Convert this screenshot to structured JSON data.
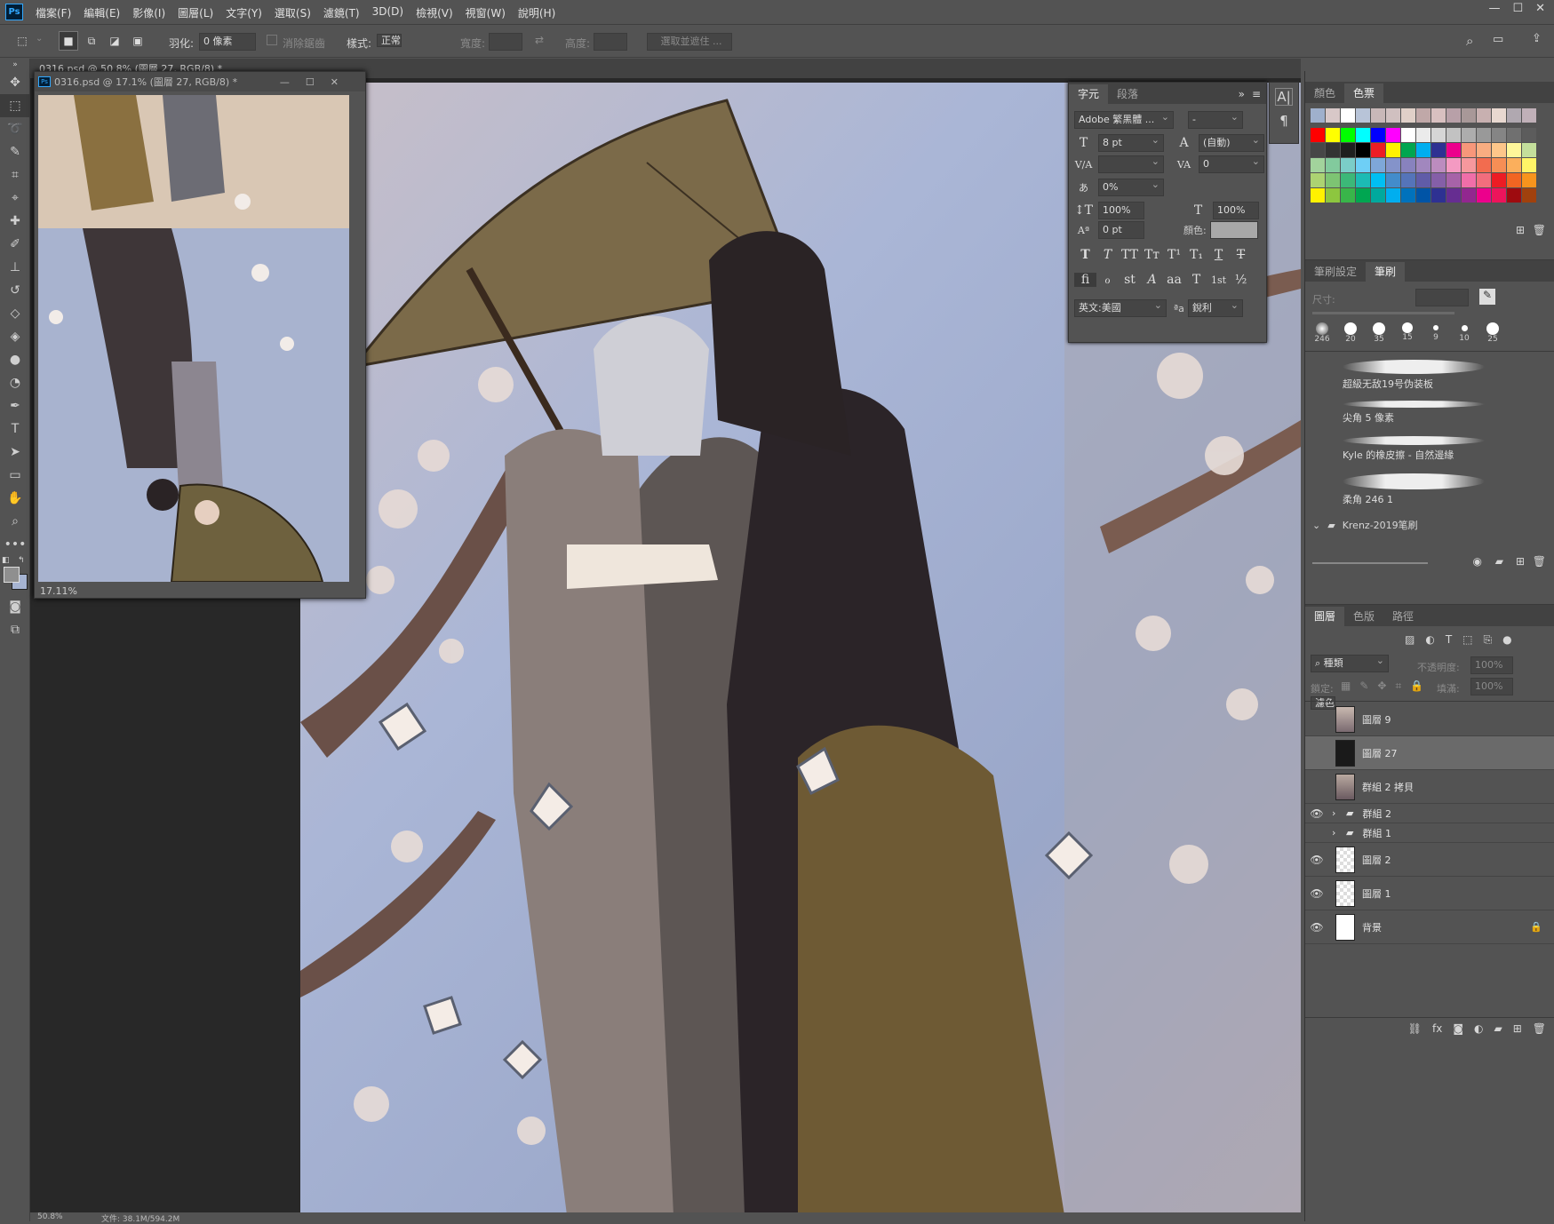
{
  "app": {
    "logo": "Ps"
  },
  "menu": [
    "檔案(F)",
    "編輯(E)",
    "影像(I)",
    "圖層(L)",
    "文字(Y)",
    "選取(S)",
    "濾鏡(T)",
    "3D(D)",
    "檢視(V)",
    "視窗(W)",
    "說明(H)"
  ],
  "options": {
    "feather_label": "羽化:",
    "feather_value": "0 像素",
    "antialias_label": "消除鋸齒",
    "style_label": "樣式:",
    "style_value": "正常",
    "width_label": "寬度:",
    "height_label": "高度:",
    "select_mask_label": "選取並遮住 ..."
  },
  "document_tab": {
    "title": "0316.psd @ 50.8% (圖層 27, RGB/8) *"
  },
  "status": {
    "zoom": "50.8%",
    "doc": "文件: 38.1M/594.2M"
  },
  "navigator_window": {
    "title": "0316.psd @ 17.1% (圖層 27, RGB/8) *",
    "zoom": "17.11%"
  },
  "character_panel": {
    "tabs": [
      "字元",
      "段落"
    ],
    "font_family": "Adobe 繁黑體 ...",
    "font_style": "-",
    "size": "8 pt",
    "leading": "(自動)",
    "kerning": "",
    "tracking": "0",
    "tsume": "0%",
    "vscale": "100%",
    "hscale": "100%",
    "baseline": "0 pt",
    "color_label": "顏色:",
    "color_value": "#a8a8a8",
    "style_buttons": [
      "T",
      "T",
      "TT",
      "Tт",
      "T¹",
      "T₁",
      "T",
      "T"
    ],
    "ot_buttons": [
      "fi",
      "ℴ",
      "st",
      "A",
      "aa",
      "T",
      "1st",
      "½"
    ],
    "language": "英文:美國",
    "aa_label": "ªa",
    "antialias": "銳利"
  },
  "swatches_panel": {
    "tabs": [
      "顏色",
      "色票"
    ],
    "active_tab": 1,
    "colors": [
      "#ff0000",
      "#ffff00",
      "#00ff00",
      "#00ffff",
      "#0000ff",
      "#ff00ff",
      "#ffffff",
      "#ebebeb",
      "#d6d6d6",
      "#c2c2c2",
      "#adadad",
      "#999999",
      "#858585",
      "#707070",
      "#5c5c5c",
      "#474747",
      "#333333",
      "#1f1f1f",
      "#000000",
      "#ee1d24",
      "#fff200",
      "#00a650",
      "#00aeef",
      "#2e3192",
      "#ec008c",
      "#f7977a",
      "#f9ad81",
      "#fdc68a",
      "#fff79a",
      "#c4df9b",
      "#a2d39c",
      "#82ca9d",
      "#7bcdc8",
      "#6ecff6",
      "#7ea7d8",
      "#8493ca",
      "#8882be",
      "#a187be",
      "#bc8cbf",
      "#f49ac2",
      "#f6989d",
      "#f26c4f",
      "#f68e55",
      "#fbaf5c",
      "#fff467",
      "#acd372",
      "#7dc473",
      "#3cb878",
      "#1cbbb4",
      "#00bff3",
      "#438ccb",
      "#5574b9",
      "#605ca8",
      "#855fa8",
      "#a763a8",
      "#f06ea9",
      "#f26d7d",
      "#ed1c24",
      "#f26522",
      "#f7941d",
      "#fff200",
      "#8dc63f",
      "#39b54a",
      "#00a651",
      "#00a99d",
      "#00aeef",
      "#0072bc",
      "#0054a6",
      "#2e3192",
      "#662d91",
      "#92278f",
      "#ec008c",
      "#ed145b",
      "#9e0b0f",
      "#a0410d"
    ],
    "recent": [
      "#9fb0cc",
      "#d8c8c8",
      "#ffffff",
      "#b8c4d8",
      "#c8b8b8",
      "#d0c0c0",
      "#e0d0c8",
      "#c0a8a8",
      "#d8c0c0",
      "#b8a0a8",
      "#a89898",
      "#c8b0b0",
      "#e8d8d0",
      "#b0a8b0",
      "#c0b0b8"
    ]
  },
  "brush_panel": {
    "tabs": [
      "筆刷設定",
      "筆刷"
    ],
    "size_label": "尺寸:",
    "tips": [
      "246",
      "20",
      "35",
      "15",
      "9",
      "10",
      "25"
    ],
    "items": [
      "超級无敌19号伪装板",
      "尖角 5 像素",
      "Kyle 的橡皮擦 - 自然邊緣",
      "柔角 246 1"
    ],
    "group": "Krenz-2019笔刷"
  },
  "layers_panel": {
    "tabs": [
      "圖層",
      "色版",
      "路徑"
    ],
    "kind": "種類",
    "blend": "濾色",
    "opacity_label": "不透明度:",
    "opacity": "100%",
    "lock_label": "鎖定:",
    "fill_label": "填滿:",
    "fill": "100%",
    "layers": [
      {
        "name": "圖層 9",
        "visible": false,
        "type": "layer"
      },
      {
        "name": "圖層 27",
        "visible": false,
        "type": "layer",
        "selected": true
      },
      {
        "name": "群組 2 拷貝",
        "visible": false,
        "type": "layer"
      },
      {
        "name": "群組 2",
        "visible": true,
        "type": "group"
      },
      {
        "name": "群組 1",
        "visible": false,
        "type": "group"
      },
      {
        "name": "圖層 2",
        "visible": true,
        "type": "layer"
      },
      {
        "name": "圖層 1",
        "visible": true,
        "type": "layer"
      },
      {
        "name": "背景",
        "visible": true,
        "type": "background",
        "locked": true
      }
    ]
  }
}
